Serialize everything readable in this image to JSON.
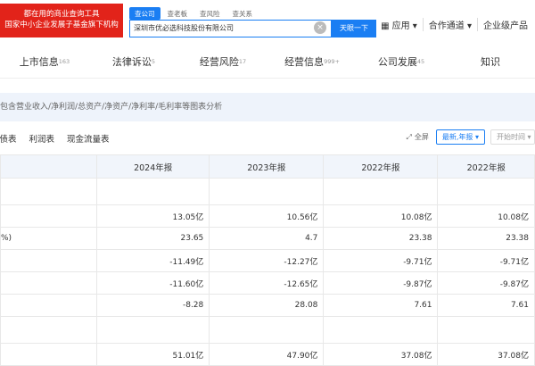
{
  "logo": {
    "line1": "都在用的商业查询工具",
    "line2": "国家中小企业发展子基金旗下机构"
  },
  "search_tabs": [
    "查公司",
    "查老板",
    "查风险",
    "查关系"
  ],
  "search": {
    "value": "深圳市优必选科技股份有限公司",
    "button": "天眼一下"
  },
  "right_nav": [
    "应用 ▾",
    "合作通道 ▾",
    "企业级产品"
  ],
  "section_tabs": [
    {
      "label": "上市信息",
      "count": "163"
    },
    {
      "label": "法律诉讼",
      "count": "5"
    },
    {
      "label": "经营风险",
      "count": "17"
    },
    {
      "label": "经营信息",
      "count": "999+"
    },
    {
      "label": "公司发展",
      "count": "45"
    },
    {
      "label": "知识",
      "count": ""
    }
  ],
  "note": "包含营业收入/净利润/总资产/净资产/净利率/毛利率等图表分析",
  "statement_tabs": [
    "负债表",
    "利润表",
    "现金流量表"
  ],
  "tools": {
    "fullscreen": "全屏",
    "sort": "最新,年报 ▾",
    "time": "开始时间 ▾"
  },
  "table": {
    "headers": [
      "2024年报",
      "2023年报",
      "2022年报",
      "2022年报"
    ],
    "rows": [
      {
        "label": "",
        "values": [
          "",
          "",
          "",
          ""
        ]
      },
      {
        "label": "",
        "values": [
          "13.05亿",
          "10.56亿",
          "10.08亿",
          "10.08亿"
        ]
      },
      {
        "label": "%)",
        "values": [
          "23.65",
          "4.7",
          "23.38",
          "23.38"
        ]
      },
      {
        "label": "",
        "values": [
          "-11.49亿",
          "-12.27亿",
          "-9.71亿",
          "-9.71亿"
        ]
      },
      {
        "label": "",
        "values": [
          "-11.60亿",
          "-12.65亿",
          "-9.87亿",
          "-9.87亿"
        ]
      },
      {
        "label": "",
        "values": [
          "-8.28",
          "28.08",
          "7.61",
          "7.61"
        ]
      },
      {
        "label": "",
        "values": [
          "",
          "",
          "",
          ""
        ]
      },
      {
        "label": "",
        "values": [
          "51.01亿",
          "47.90亿",
          "37.08亿",
          "37.08亿"
        ]
      }
    ]
  },
  "colors": {
    "accent": "#1a7ef3",
    "logo_red": "#e2231a",
    "note_bg": "#eef3fb"
  }
}
